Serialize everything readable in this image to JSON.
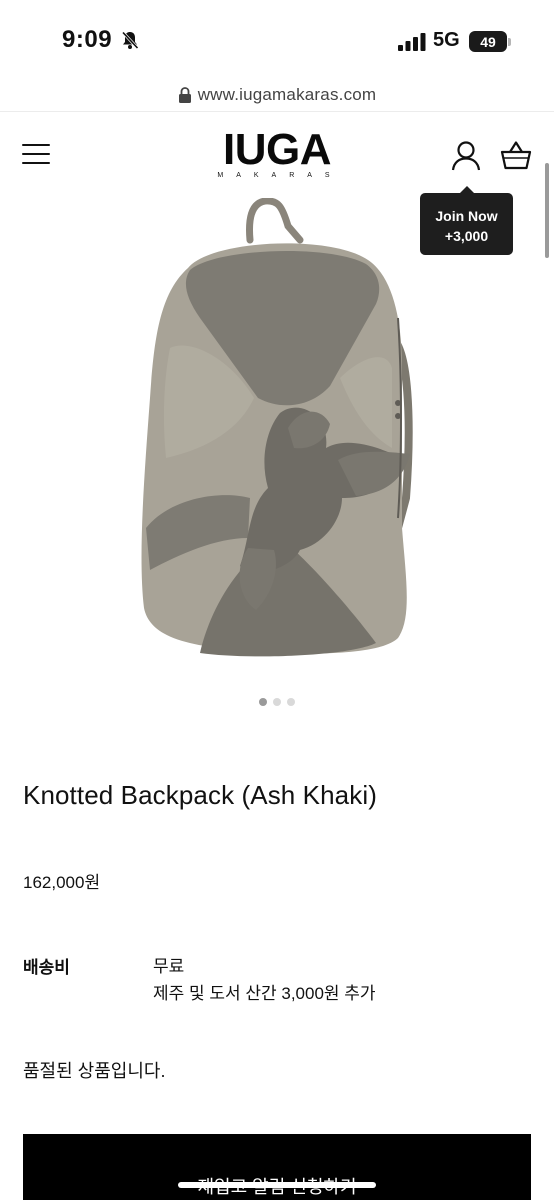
{
  "status_bar": {
    "time": "9:09",
    "network": "5G",
    "battery": "49",
    "icons": [
      "bell-slash-icon",
      "signal-icon"
    ]
  },
  "browser": {
    "url": "www.iugamakaras.com",
    "icons": [
      "lock-icon"
    ]
  },
  "header": {
    "logo_main": "IUGA",
    "logo_sub": "MAKARAS",
    "icons": [
      "menu-icon",
      "account-icon",
      "cart-icon"
    ]
  },
  "tooltip": {
    "line1": "Join Now",
    "line2": "+3,000"
  },
  "product": {
    "title": "Knotted Backpack (Ash Khaki)",
    "price": "162,000원",
    "shipping_label": "배송비",
    "shipping_value": "무료",
    "shipping_note": "제주 및 도서 산간 3,000원 추가",
    "stock_status": "품절된 상품입니다.",
    "restock_label": "재입고 알림 신청하기",
    "image_count": 3,
    "active_image": 1
  },
  "colors": {
    "bag_body": "#a8a397",
    "bag_shadow": "#8a857b",
    "bag_strap": "#727069",
    "button_bg": "#000000",
    "tooltip_bg": "#1e1e1e"
  }
}
